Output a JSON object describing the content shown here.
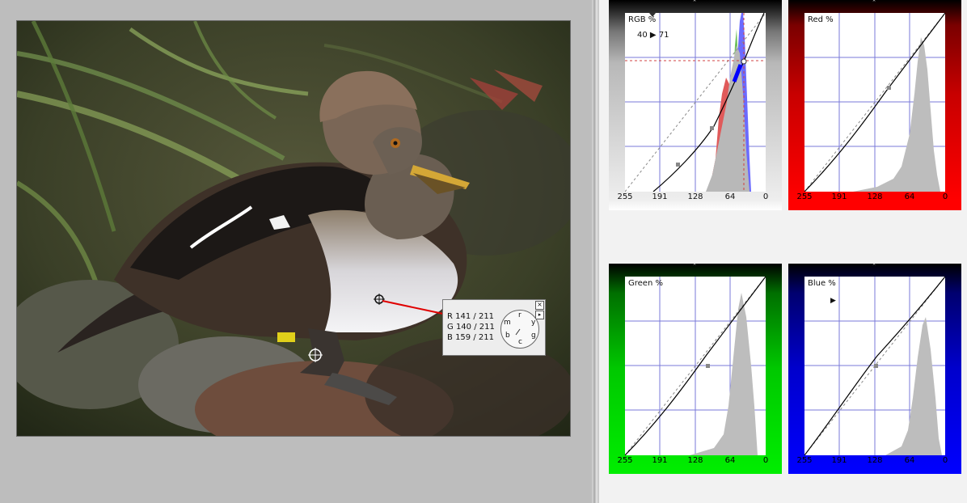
{
  "sample_popup": {
    "close": "×",
    "menu": "▸",
    "rows": [
      {
        "label": "R",
        "value": "141 / 211"
      },
      {
        "label": "G",
        "value": "140 / 211"
      },
      {
        "label": "B",
        "value": "159 / 211"
      }
    ],
    "wheel_letters": {
      "r": "r",
      "y": "y",
      "g": "g",
      "c": "c",
      "b": "b",
      "m": "m"
    }
  },
  "panels": {
    "rgb": {
      "title": "RGB %",
      "readout_in": "40",
      "readout_arrow": "▶",
      "readout_out": "71",
      "ticks": [
        "255",
        "191",
        "128",
        "64",
        "0"
      ],
      "accent": "#808080"
    },
    "red": {
      "title": "Red %",
      "ticks": [
        "255",
        "191",
        "128",
        "64",
        "0"
      ],
      "accent": "#ff0000"
    },
    "green": {
      "title": "Green %",
      "ticks": [
        "255",
        "191",
        "128",
        "64",
        "0"
      ],
      "accent": "#00cc00"
    },
    "blue": {
      "title": "Blue %",
      "marker": "▶",
      "ticks": [
        "255",
        "191",
        "128",
        "64",
        "0"
      ],
      "accent": "#0000ff"
    }
  },
  "notch_symbol": "⌃"
}
